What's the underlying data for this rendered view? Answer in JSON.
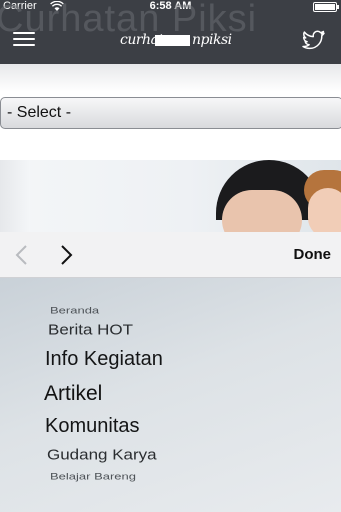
{
  "status_bar": {
    "carrier": "Carrier",
    "time": "6:58 AM",
    "wifi_icon": "wifi-icon",
    "battery_level": 1.0
  },
  "header": {
    "watermark": "Curhatan Piksi",
    "logo_left": "curhat",
    "logo_right": "npiksi",
    "menu_icon": "hamburger-menu-icon",
    "twitter_icon": "twitter-bird-icon",
    "background": "#3c3f45"
  },
  "select": {
    "value": "- Select -"
  },
  "picker": {
    "prev_icon": "chevron-left-icon",
    "next_icon": "chevron-right-icon",
    "done_label": "Done",
    "items": [
      "Beranda",
      "Berita HOT",
      "Info Kegiatan",
      "Artikel",
      "Komunitas",
      "Gudang Karya",
      "Belajar Bareng"
    ]
  }
}
